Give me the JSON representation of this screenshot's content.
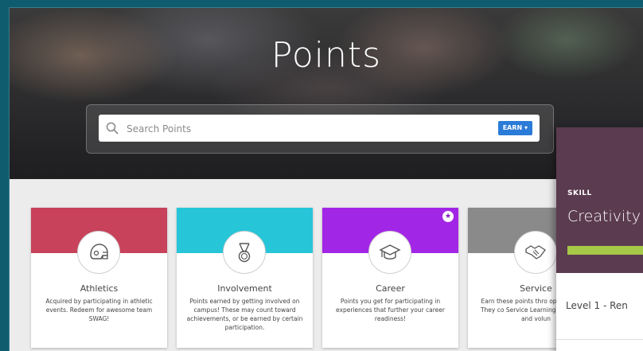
{
  "hero": {
    "title": "Points"
  },
  "search": {
    "placeholder": "Search Points",
    "earn_label": "EARN ▾"
  },
  "cards": [
    {
      "title": "Athletics",
      "description": "Acquired by participating in athletic events. Redeem for awesome team SWAG!",
      "color": "#c7425a",
      "icon": "football-helmet-icon"
    },
    {
      "title": "Involvement",
      "description": "Points earned by getting involved on campus! These may count toward achievements, or be earned by certain participation.",
      "color": "#27c5d8",
      "icon": "medal-icon"
    },
    {
      "title": "Career",
      "description": "Points you get for participating in experiences that further your career readiness!",
      "color": "#a226e6",
      "icon": "graduation-cap-icon",
      "favorite": true
    },
    {
      "title": "Service",
      "description": "Earn these points thro opportunities. They co Service Learning goals there and volun",
      "color": "#8a8a8a",
      "icon": "handshake-icon"
    }
  ],
  "panel": {
    "label": "SKILL",
    "title": "Creativity",
    "level": "Level 1 - Ren",
    "header_color": "#5b3b50",
    "bar_color": "#a6c948"
  }
}
